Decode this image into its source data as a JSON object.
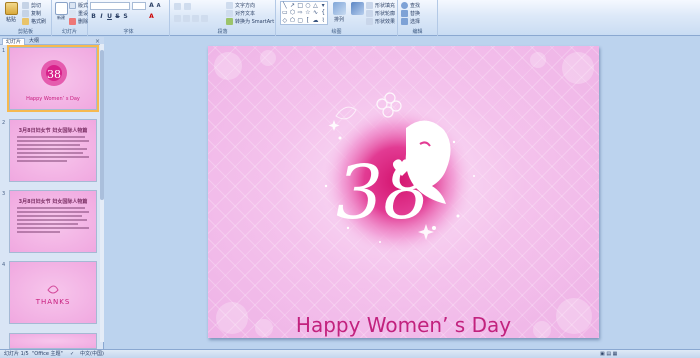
{
  "ribbon": {
    "clipboard": {
      "paste": "粘贴",
      "cut": "剪切",
      "copy": "复制",
      "format_painter": "格式刷",
      "group": "剪贴板"
    },
    "slides": {
      "new_slide": "新建\n幻灯片",
      "layout": "版式",
      "reset": "重设",
      "delete": "删除",
      "group": "幻灯片"
    },
    "font": {
      "group": "字体"
    },
    "paragraph": {
      "text_direction": "文字方向",
      "align_text": "对齐文本",
      "smartart": "转换为 SmartArt",
      "group": "段落"
    },
    "drawing": {
      "arrange": "排列",
      "quick_styles": "快速样式",
      "shape_fill": "形状填充",
      "shape_outline": "形状轮廓",
      "shape_effects": "形状效果",
      "group": "绘图"
    },
    "editing": {
      "find": "查找",
      "replace": "替换",
      "select": "选择",
      "group": "编辑"
    }
  },
  "panel": {
    "tab_slides": "幻灯片",
    "tab_outline": "大纲",
    "thumbnails": [
      {
        "num": "1",
        "title": "Happy Women’ s Day"
      },
      {
        "num": "2",
        "title": "3月8日妇女节 妇女国际人物篇"
      },
      {
        "num": "3",
        "title": "3月8日妇女节 妇女国际人物篇"
      },
      {
        "num": "4",
        "title": "THANKS"
      }
    ]
  },
  "slide": {
    "title": "Happy Women’ s Day",
    "emblem_number": "38"
  },
  "status": {
    "slide_counter": "幻灯片 1/5",
    "theme": "\"Office 主题\"",
    "language": "中文(中国)"
  },
  "colors": {
    "accent_pink": "#c2227e",
    "ribbon_blue": "#dde9f8"
  }
}
